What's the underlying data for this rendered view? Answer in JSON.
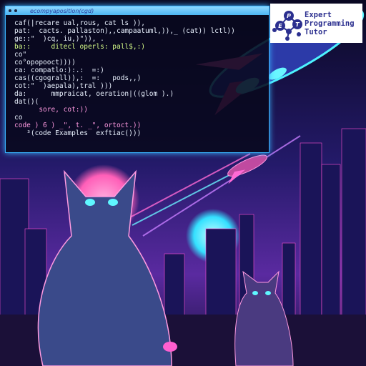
{
  "code_window": {
    "title": "ecompyapositlon(cgd)",
    "lines": [
      "caf(|recare ual,rous, cat ls )),",
      "pat:  cacts. pallaston),,campaatuml,)),_ (cat)) lctl))",
      "ge::\"  )cq, iu,)\")), .",
      "ba::     ditecl operls: pall$,:)",
      "co\"",
      "co°opopooct))))",
      "ca: compatlo:):.:  =:)",
      "cas((cgograll)),:  =:   pods,,)",
      "cot:\"  )aepala),tral )))",
      "da:      mmpraicat, oeration|((glom ).)",
      "dat()(",
      "      sore, cot:))",
      "co",
      "code ) 6 ) _\", t. _\", ortoct.))",
      "",
      "   ³(code Examples  exftiac()))"
    ]
  },
  "logo": {
    "letters": [
      "E",
      "P",
      "T"
    ],
    "lines": [
      "Expert",
      "Programming",
      "Tutor"
    ],
    "color": "#2b2f8f"
  }
}
